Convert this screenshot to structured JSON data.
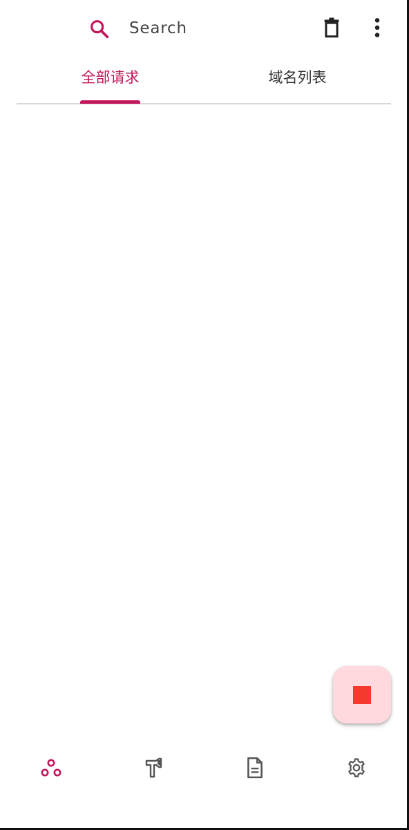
{
  "topbar": {
    "search_placeholder": "Search",
    "icons": {
      "search": "search-icon",
      "delete": "trash-icon",
      "more": "more-vert-icon"
    }
  },
  "tabs": [
    {
      "label": "全部请求",
      "selected": true
    },
    {
      "label": "域名列表",
      "selected": false
    }
  ],
  "fab": {
    "icon": "stop-icon",
    "color": "#f43a2e",
    "background": "#ffd9dd"
  },
  "bottom_nav": [
    {
      "icon": "network-nodes-icon",
      "selected": true
    },
    {
      "icon": "hammer-icon",
      "selected": false
    },
    {
      "icon": "document-icon",
      "selected": false
    },
    {
      "icon": "gear-icon",
      "selected": false
    }
  ],
  "colors": {
    "accent": "#c2185b",
    "text": "#333333",
    "icon": "#555555"
  }
}
